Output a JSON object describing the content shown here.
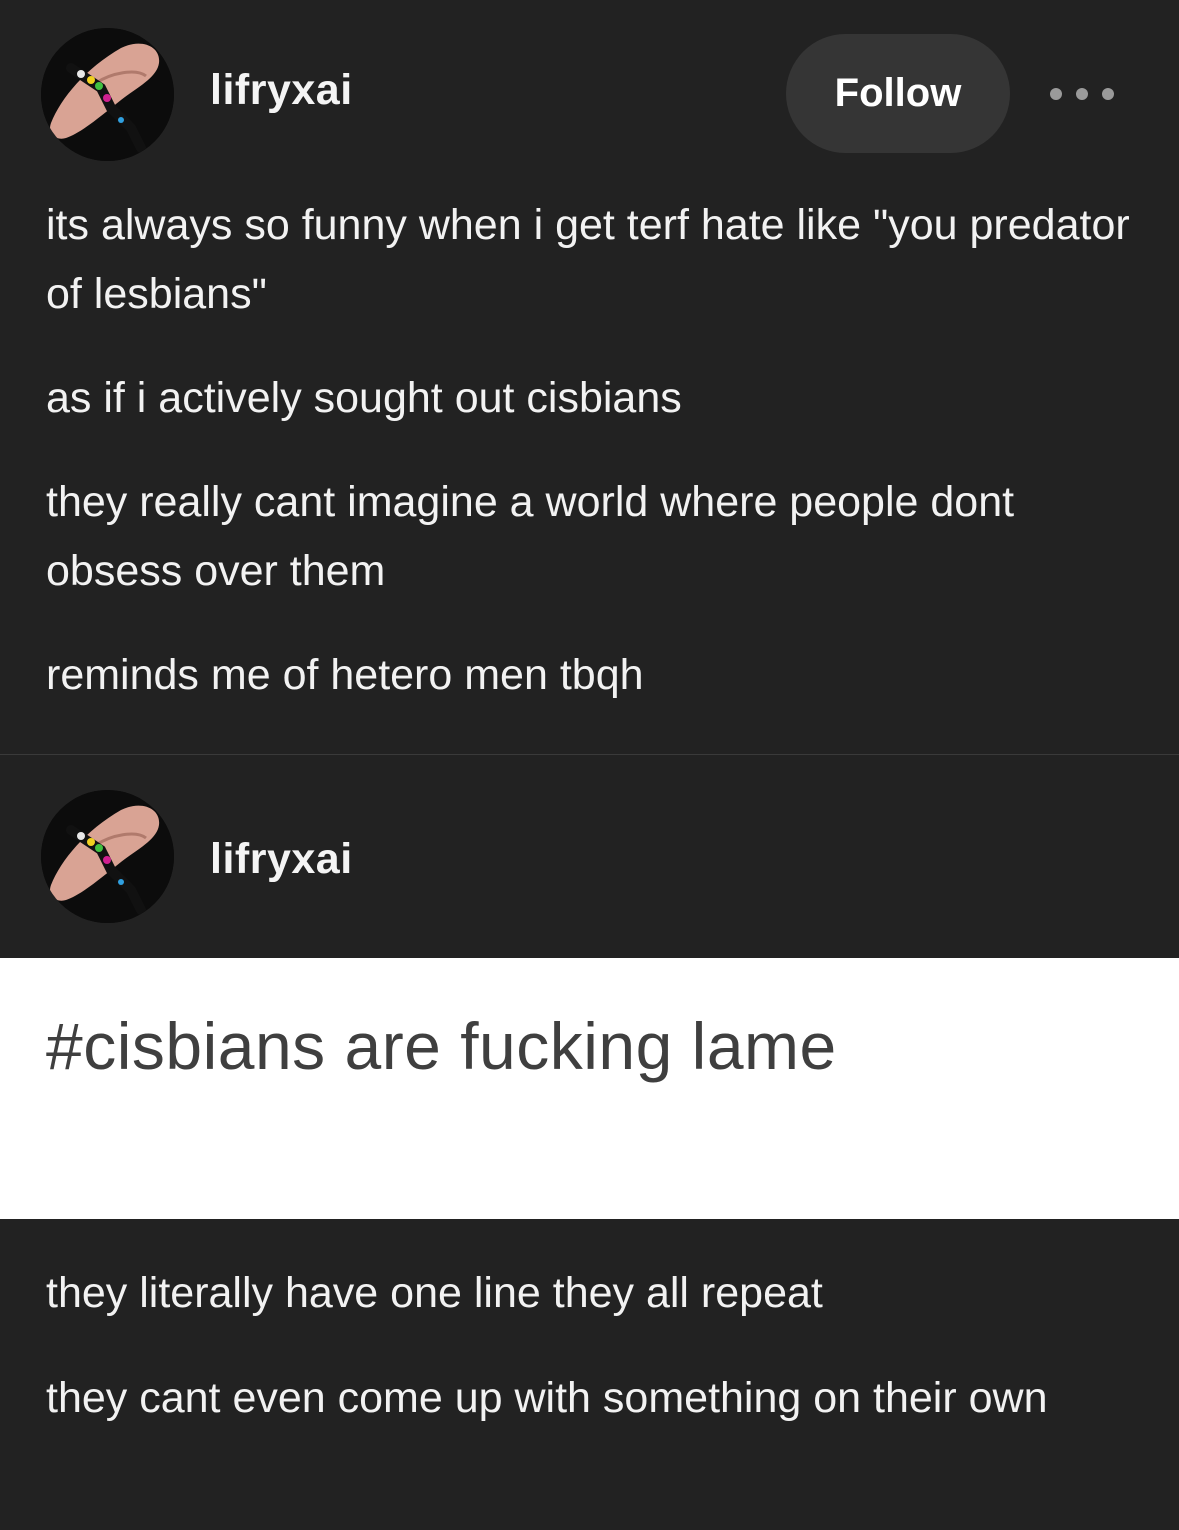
{
  "post": {
    "username": "lifryxai",
    "follow_label": "Follow",
    "more_icon": "more-options-icon",
    "paragraphs": [
      "its always so funny when i get terf hate like \"you predator of lesbians\"",
      "as if i actively sought out cisbians",
      "they really cant imagine a world where people dont obsess over them",
      "reminds me of hetero men tbqh"
    ]
  },
  "reblog": {
    "username": "lifryxai",
    "image_text": "#cisbians are fucking lame",
    "paragraphs": [
      "they literally have one line they all repeat",
      "they cant even come up with something on their own"
    ]
  },
  "colors": {
    "background": "#222222",
    "follow_button": "#353535",
    "image_background": "#ffffff",
    "image_text": "#3f3f3f"
  }
}
